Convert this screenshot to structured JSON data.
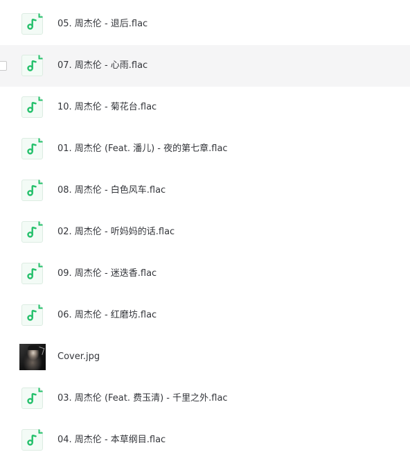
{
  "files": [
    {
      "name": "05. 周杰伦 - 退后.flac",
      "type": "audio",
      "icon": "music-file-icon"
    },
    {
      "name": "07. 周杰伦 - 心雨.flac",
      "type": "audio",
      "icon": "music-file-icon",
      "hovered": true
    },
    {
      "name": "10. 周杰伦 - 菊花台.flac",
      "type": "audio",
      "icon": "music-file-icon"
    },
    {
      "name": "01. 周杰伦 (Feat. 潘儿) - 夜的第七章.flac",
      "type": "audio",
      "icon": "music-file-icon"
    },
    {
      "name": "08. 周杰伦 - 白色风车.flac",
      "type": "audio",
      "icon": "music-file-icon"
    },
    {
      "name": "02. 周杰伦 - 听妈妈的话.flac",
      "type": "audio",
      "icon": "music-file-icon"
    },
    {
      "name": "09. 周杰伦 - 迷迭香.flac",
      "type": "audio",
      "icon": "music-file-icon"
    },
    {
      "name": "06. 周杰伦 - 红磨坊.flac",
      "type": "audio",
      "icon": "music-file-icon"
    },
    {
      "name": "Cover.jpg",
      "type": "image",
      "icon": "image-thumbnail"
    },
    {
      "name": "03. 周杰伦 (Feat. 费玉清) - 千里之外.flac",
      "type": "audio",
      "icon": "music-file-icon"
    },
    {
      "name": "04. 周杰伦 - 本草纲目.flac",
      "type": "audio",
      "icon": "music-file-icon"
    }
  ],
  "colors": {
    "audio_icon_green": "#24c06b",
    "audio_icon_bg": "#f3fbf6",
    "row_hover_bg": "#f5f5f6",
    "text": "#33353a"
  }
}
